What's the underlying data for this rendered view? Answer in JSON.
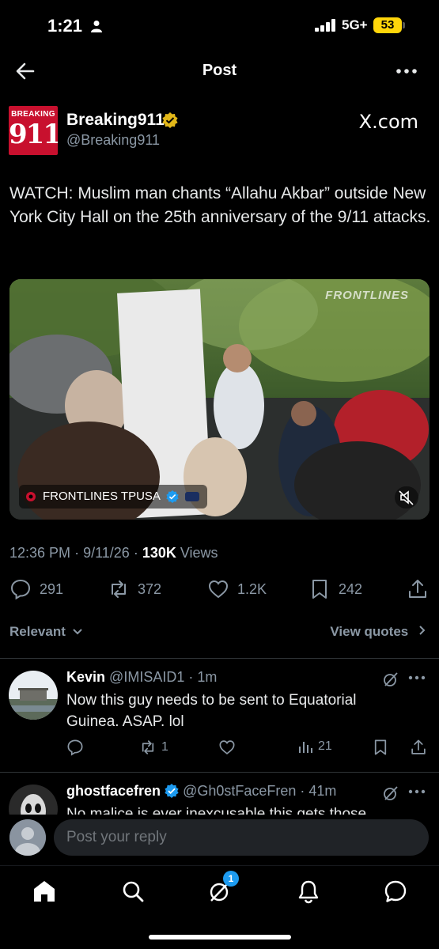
{
  "status_bar": {
    "time": "1:21",
    "network": "5G+",
    "battery": "53"
  },
  "header": {
    "title": "Post"
  },
  "post": {
    "author": {
      "avatar_top": "BREAKING",
      "avatar_number": "911",
      "name": "Breaking911",
      "handle": "@Breaking911",
      "bio_link": "X.com"
    },
    "text": "WATCH: Muslim man chants “Allahu Akbar” outside New York City Hall on the 25th anniversary of the 9/11 attacks.",
    "media": {
      "watermark": "FRONTLINES",
      "source_label": "FRONTLINES TPUSA"
    },
    "meta": {
      "time": "12:36 PM",
      "date": "9/11/26",
      "views": "130K",
      "views_label": "Views"
    },
    "actions": {
      "replies": "291",
      "reposts": "372",
      "likes": "1.2K",
      "bookmarks": "242"
    }
  },
  "replies_header": {
    "sort_label": "Relevant",
    "view_quotes": "View quotes"
  },
  "replies": [
    {
      "name": "Kevin",
      "handle": "@IMISAID1",
      "time": "1m",
      "text": "Now this guy needs to be sent to Equatorial Guinea. ASAP. lol",
      "reposts": "1",
      "views": "21"
    },
    {
      "name": "ghostfacefren",
      "handle": "@Gh0stFaceFren",
      "time": "41m",
      "text": "No malice is ever inexcusable this gets those"
    }
  ],
  "composer": {
    "placeholder": "Post your reply"
  },
  "nav": {
    "messages_badge": "1"
  },
  "colors": {
    "accent": "#1d9bf0",
    "gold_badge": "#e2b719",
    "muted": "#8b98a5"
  }
}
